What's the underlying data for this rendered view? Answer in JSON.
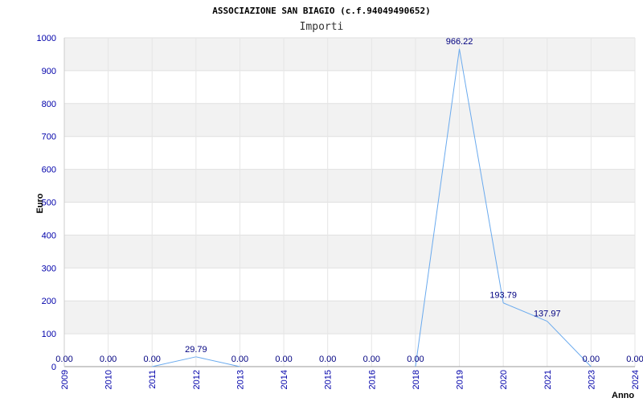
{
  "chart_data": {
    "type": "line",
    "title": "ASSOCIAZIONE SAN BIAGIO (c.f.94049490652)",
    "subtitle": "Importi",
    "xlabel": "Anno",
    "ylabel": "Euro",
    "ylim": [
      0,
      1000
    ],
    "yticks": [
      "0",
      "100",
      "200",
      "300",
      "400",
      "500",
      "600",
      "700",
      "800",
      "900",
      "1000"
    ],
    "categories": [
      "2009",
      "2010",
      "2011",
      "2012",
      "2013",
      "2014",
      "2015",
      "2016",
      "2018",
      "2019",
      "2020",
      "2021",
      "2023",
      "2024"
    ],
    "values": [
      0,
      0,
      0,
      29.79,
      0,
      0,
      0,
      0,
      0,
      966.22,
      193.79,
      137.97,
      0,
      0
    ],
    "labels": [
      "0.00",
      "0.00",
      "0.00",
      "29.79",
      "0.00",
      "0.00",
      "0.00",
      "0.00",
      "0.00",
      "966.22",
      "193.79",
      "137.97",
      "0.00",
      "0.00"
    ],
    "grid": true,
    "colors": {
      "line": "#6aaaee",
      "band": "#f2f2f2",
      "tick": "#0000aa",
      "label": "#000080"
    }
  }
}
